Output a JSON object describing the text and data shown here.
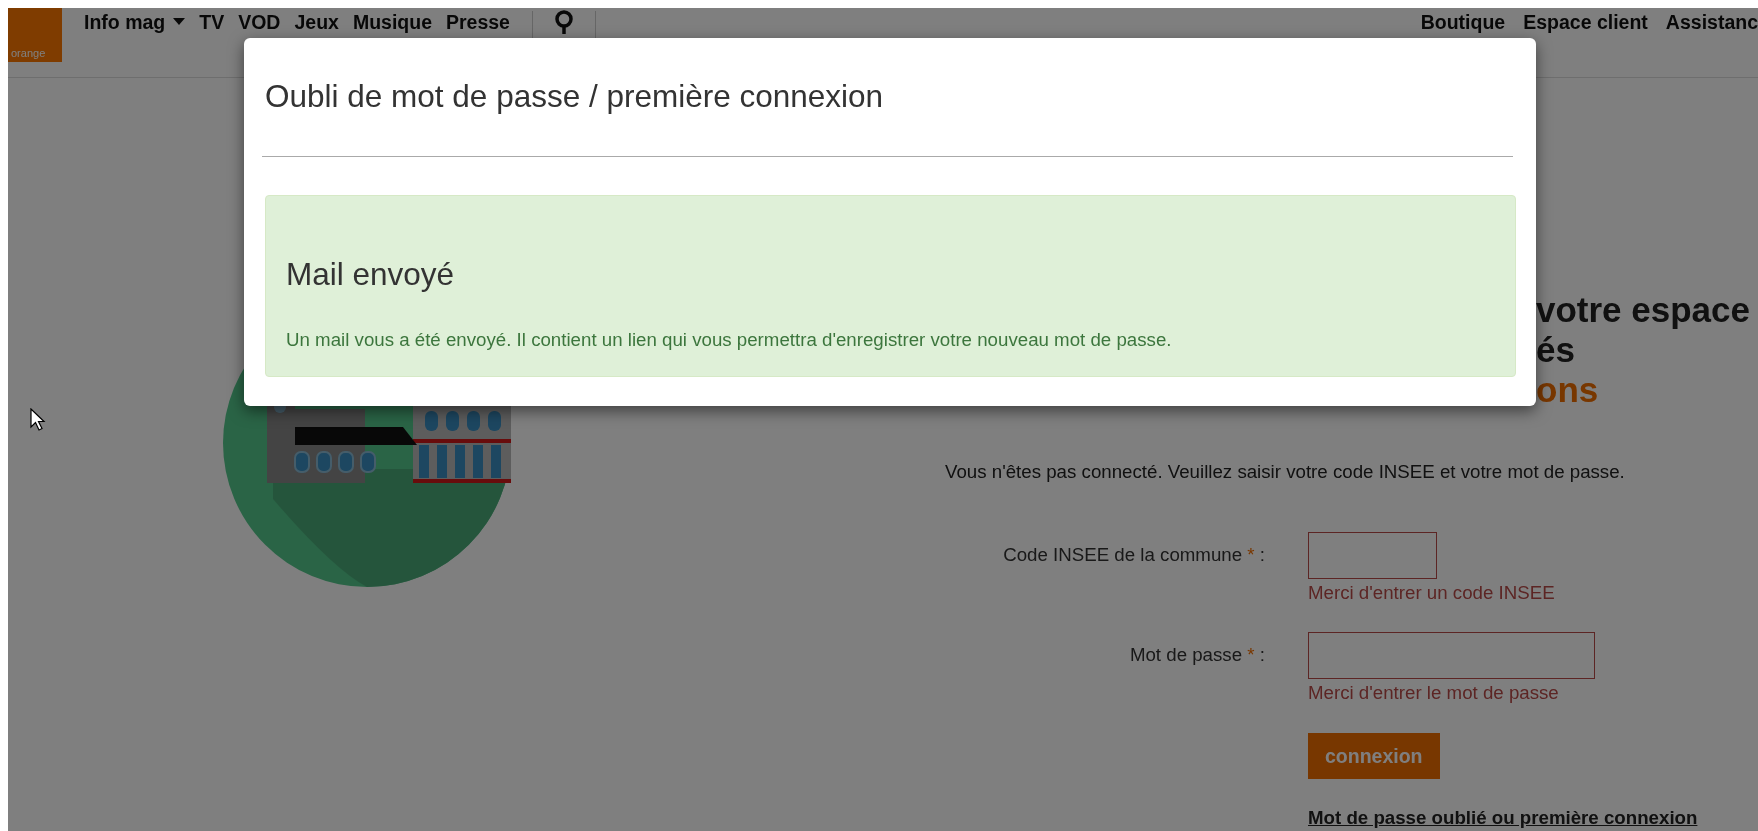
{
  "nav": {
    "logo": "orange",
    "items": [
      {
        "label": "Info mag",
        "dropdown": true
      },
      {
        "label": "TV",
        "dropdown": false
      },
      {
        "label": "VOD",
        "dropdown": false
      },
      {
        "label": "Jeux",
        "dropdown": false
      },
      {
        "label": "Musique",
        "dropdown": false
      },
      {
        "label": "Presse",
        "dropdown": false
      }
    ],
    "right_items": [
      "Boutique",
      "Espace client",
      "Assistanc"
    ]
  },
  "headline": [
    {
      "text": "votre espace",
      "accent": false
    },
    {
      "text": "és",
      "accent": false
    },
    {
      "text": "ons",
      "accent": true
    }
  ],
  "login": {
    "intro": "Vous n'êtes pas connecté. Veuillez saisir votre code INSEE et votre mot de passe.",
    "fields": [
      {
        "label": "Code INSEE de la commune",
        "mark": "*",
        "suffix": ":",
        "kind": "short",
        "invalid": true,
        "error": "Merci d'entrer un code INSEE"
      },
      {
        "label": "Mot de passe",
        "mark": "*",
        "suffix": ":",
        "kind": "long",
        "invalid": true,
        "error": "Merci d'entrer le mot de passe"
      }
    ],
    "button": "connexion",
    "link": "Mot de passe oublié ou première connexion"
  },
  "modal": {
    "title": "Oubli de mot de passe / première connexion",
    "alert": {
      "kind": "success",
      "heading": "Mail envoyé",
      "message": "Un mail vous a été envoyé. Il contient un lien qui vous permettra d'enregistrer votre nouveau mot de passe."
    }
  }
}
